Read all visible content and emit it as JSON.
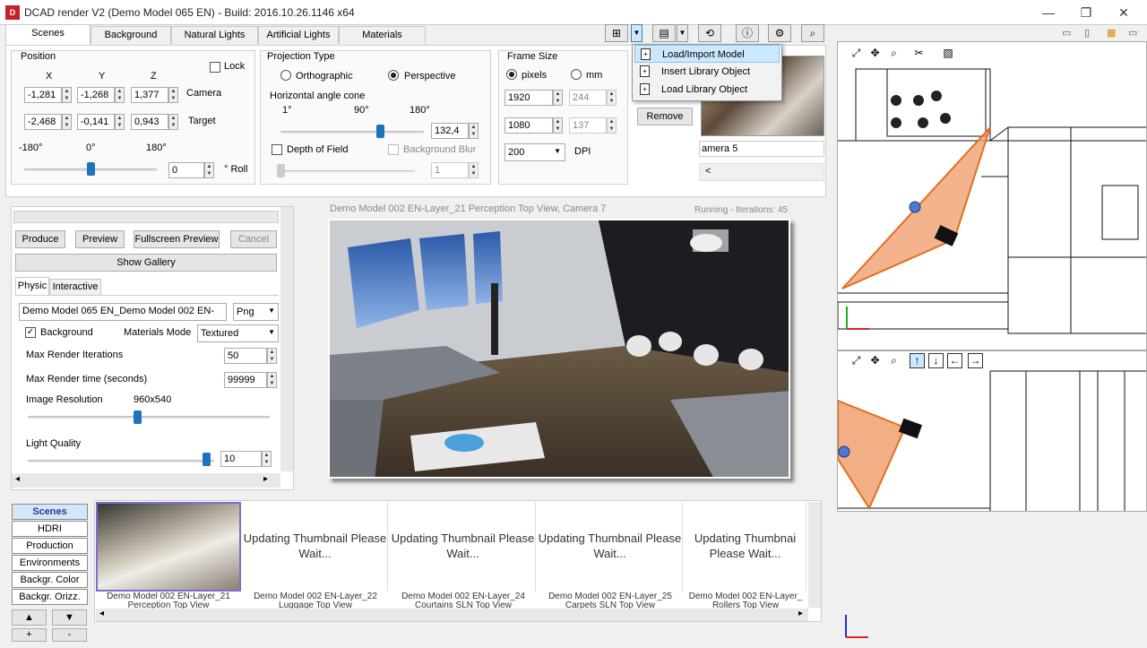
{
  "window": {
    "title": "DCAD render V2 (Demo Model 065 EN) - Build: 2016.10.26.1146 x64",
    "icon": "D",
    "minimize": "—",
    "maximize": "❐",
    "close": "✕"
  },
  "tabs": [
    {
      "label": "Scenes"
    },
    {
      "label": "Background"
    },
    {
      "label": "Natural Lights"
    },
    {
      "label": "Artificial Lights"
    },
    {
      "label": "Materials"
    }
  ],
  "position": {
    "title": "Position",
    "lock_label": "Lock",
    "x_label": "X",
    "y_label": "Y",
    "z_label": "Z",
    "camera_label": "Camera",
    "target_label": "Target",
    "camera": {
      "x": "-1,281",
      "y": "-1,268",
      "z": "1,377"
    },
    "target": {
      "x": "-2,468",
      "y": "-0,141",
      "z": "0,943"
    },
    "roll_min": "-180°",
    "roll_mid": "0°",
    "roll_max": "180°",
    "roll_value": "0",
    "roll_label": "° Roll",
    "roll_fraction": 0.5
  },
  "projection": {
    "title": "Projection Type",
    "ortho_label": "Orthographic",
    "persp_label": "Perspective",
    "selected": "Perspective",
    "angle_title": "Horizontal angle cone",
    "angle_min": "1°",
    "angle_mid": "90°",
    "angle_max": "180°",
    "angle_value": "132,4",
    "dof_label": "Depth of Field",
    "blur_label": "Background Blur",
    "blur_value": "1"
  },
  "frame": {
    "title": "Frame Size",
    "pixels_label": "pixels",
    "mm_label": "mm",
    "width": "1920",
    "height": "1080",
    "width_mm": "244",
    "height_mm": "137",
    "dpi_value": "200",
    "dpi_label": "DPI"
  },
  "camera_panel": {
    "remove_label": "Remove",
    "camera_name": "amera 5",
    "scroll_left": "<"
  },
  "import_menu": {
    "items": [
      {
        "label": "Load/Import Model"
      },
      {
        "label": "Insert Library Object"
      },
      {
        "label": "Load Library Object"
      }
    ]
  },
  "render": {
    "produce": "Produce",
    "preview": "Preview",
    "fullscreen": "Fullscreen Preview",
    "cancel": "Cancel",
    "gallery": "Show Gallery",
    "tab_physic": "Physic",
    "tab_interactive": "Interactive",
    "filename": "Demo Model 065 EN_Demo Model 002 EN-",
    "format": "Png",
    "background_label": "Background",
    "materials_mode_label": "Materials Mode",
    "materials_mode": "Textured",
    "max_iter_label": "Max Render Iterations",
    "max_iter": "50",
    "max_time_label": "Max Render time (seconds)",
    "max_time": "99999",
    "image_res_label": "Image Resolution",
    "image_res": "960x540",
    "light_quality_label": "Light Quality",
    "light_quality": "10"
  },
  "viewport": {
    "caption": "Demo Model 002 EN-Layer_21 Perception Top View, Camera 7",
    "status": "Running - Iterations: 45"
  },
  "left_nav": [
    {
      "label": "Scenes"
    },
    {
      "label": "HDRI"
    },
    {
      "label": "Production"
    },
    {
      "label": "Environments"
    },
    {
      "label": "Backgr. Color"
    },
    {
      "label": "Backgr. Orizz."
    }
  ],
  "nav_arrows": {
    "up": "▲",
    "down": "▼",
    "plus": "+",
    "minus": "-"
  },
  "gallery": {
    "tiles": [
      {
        "text": "",
        "caption": "Demo Model 002 EN-Layer_21 Perception Top View"
      },
      {
        "text": "Updating Thumbnail Please Wait...",
        "caption": "Demo Model 002 EN-Layer_22 Luggage Top View"
      },
      {
        "text": "Updating Thumbnail Please Wait...",
        "caption": "Demo Model 002 EN-Layer_24 Courtains SLN Top View"
      },
      {
        "text": "Updating Thumbnail Please Wait...",
        "caption": "Demo Model 002 EN-Layer_25 Carpets SLN Top View"
      },
      {
        "text": "Updating Thumbnai Please Wait...",
        "caption": "Demo Model 002 EN-Layer_ Rollers Top View"
      }
    ]
  },
  "colors": {
    "accent": "#1e73be",
    "selected_nav": "#d5e6f8",
    "frustum": "#f0a070"
  }
}
